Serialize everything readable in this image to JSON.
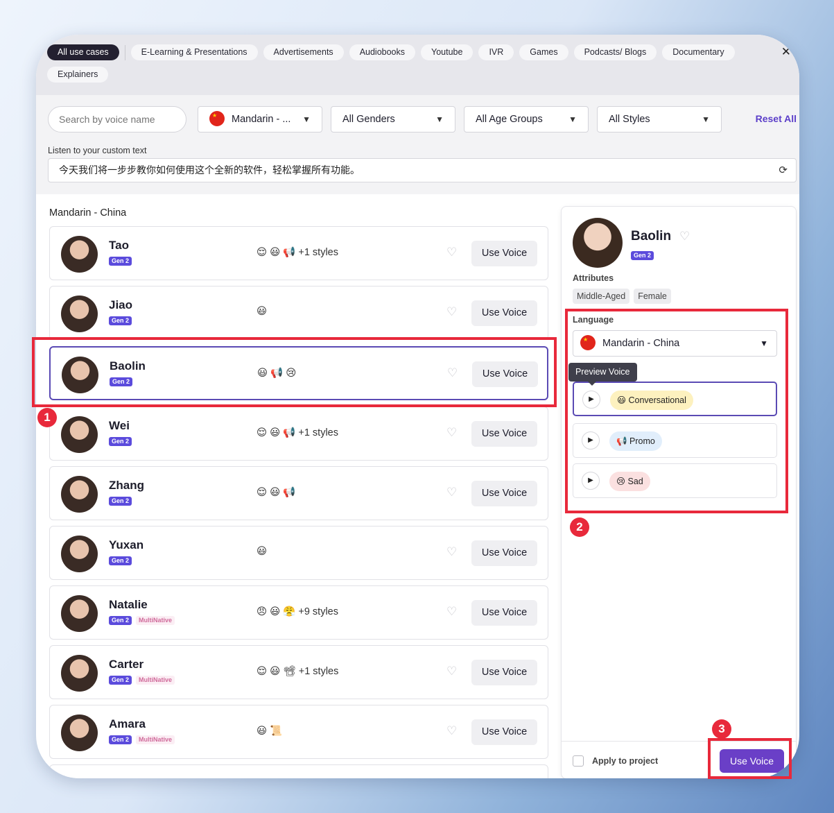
{
  "header": {
    "chips": [
      "All use cases",
      "E-Learning & Presentations",
      "Advertisements",
      "Audiobooks",
      "Youtube",
      "IVR",
      "Games",
      "Podcasts/ Blogs",
      "Documentary",
      "Explainers"
    ],
    "close": "✕"
  },
  "filters": {
    "search_placeholder": "Search by voice name",
    "language": "Mandarin - ...",
    "gender": "All Genders",
    "age": "All Age Groups",
    "style": "All Styles",
    "reset": "Reset All",
    "custom_label": "Listen to your custom text",
    "custom_text": "今天我们将一步步教你如何使用这个全新的软件，轻松掌握所有功能。"
  },
  "list": {
    "section_title": "Mandarin - China",
    "use_label": "Use Voice",
    "gen_label": "Gen 2",
    "multi_label": "MultiNative",
    "voices": [
      {
        "name": "Tao",
        "styles": "😌 😃 📢 +1 styles"
      },
      {
        "name": "Jiao",
        "styles": "😃"
      },
      {
        "name": "Baolin",
        "styles": "😃 📢 😢"
      },
      {
        "name": "Wei",
        "styles": "😌 😃 📢 +1 styles"
      },
      {
        "name": "Zhang",
        "styles": "😌 😃 📢"
      },
      {
        "name": "Yuxan",
        "styles": "😃"
      },
      {
        "name": "Natalie",
        "styles": "😠 😃 😤 +9 styles"
      },
      {
        "name": "Carter",
        "styles": "😌 😃 📽 +1 styles"
      },
      {
        "name": "Amara",
        "styles": "😃 📜"
      }
    ]
  },
  "panel": {
    "name": "Baolin",
    "gen": "Gen 2",
    "attributes_label": "Attributes",
    "attributes": [
      "Middle-Aged",
      "Female"
    ],
    "language_label": "Language",
    "language": "Mandarin - China",
    "tooltip": "Preview Voice",
    "styles": [
      {
        "label": "😃 Conversational",
        "color": "#fdf1bf"
      },
      {
        "label": "📢 Promo",
        "color": "#e1eefb"
      },
      {
        "label": "😢 Sad",
        "color": "#fbe0e0"
      }
    ],
    "apply_label": "Apply to project",
    "use_label": "Use Voice"
  },
  "annotations": {
    "one": "1",
    "two": "2",
    "three": "3"
  },
  "colors": {
    "accent": "#6a3fc7",
    "annotation": "#e8293b"
  }
}
